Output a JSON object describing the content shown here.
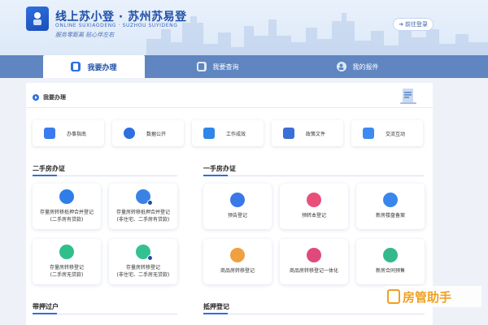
{
  "header": {
    "title": "线上苏小登 · 苏州苏易登",
    "subtitle": "ONLINE SUXIAODENG · SUZHOU SUYIDENG",
    "slogan": "服务零距离   贴心伴左右",
    "login_label": "前往登录"
  },
  "nav": {
    "tabs": [
      {
        "label": "我要办理",
        "active": true
      },
      {
        "label": "我要查询",
        "active": false
      },
      {
        "label": "我的报件",
        "active": false
      }
    ]
  },
  "main": {
    "breadcrumb": "我要办理",
    "quick_links": [
      {
        "label": "办事指南",
        "icon": "guide-icon",
        "color": "#3a7cf0"
      },
      {
        "label": "数据公开",
        "icon": "pie-chart-icon",
        "color": "#2f6fe0"
      },
      {
        "label": "工作成效",
        "icon": "trophy-icon",
        "color": "#2f86e8"
      },
      {
        "label": "政策文件",
        "icon": "document-icon",
        "color": "#3a6fd6"
      },
      {
        "label": "交流互动",
        "icon": "chat-icon",
        "color": "#3d8af0"
      }
    ],
    "sections": {
      "second_hand": {
        "title": "二手房办证",
        "cards": [
          {
            "line1": "存量房转移抵押合并登记",
            "line2": "(二手房有贷款)",
            "icon": "house-arrow-icon",
            "color": "#2f7de8"
          },
          {
            "line1": "存量房转移抵押合并登记",
            "line2": "(非住宅、二手房有贷款)",
            "icon": "house-arrow-icon",
            "color": "#3b82e6"
          },
          {
            "line1": "存量房转移登记",
            "line2": "(二手房无贷款)",
            "icon": "house-refresh-icon",
            "color": "#2fbf8a"
          },
          {
            "line1": "存量房转移登记",
            "line2": "(非住宅、二手房无贷款)",
            "icon": "house-refresh-icon",
            "color": "#34c191"
          }
        ]
      },
      "first_hand": {
        "title": "一手房办证",
        "cards": [
          {
            "line1": "预告登记",
            "line2": "",
            "icon": "bell-icon",
            "color": "#3878e8"
          },
          {
            "line1": "预转本登记",
            "line2": "",
            "icon": "transfer-icon",
            "color": "#e8507a"
          },
          {
            "line1": "新房楼盘备案",
            "line2": "",
            "icon": "building-icon",
            "color": "#3b86ec"
          },
          {
            "line1": "商品房转移登记",
            "line2": "",
            "icon": "certificate-icon",
            "color": "#f0a040"
          },
          {
            "line1": "商品房转移登记一体化",
            "line2": "",
            "icon": "integration-icon",
            "color": "#e04a7a"
          },
          {
            "line1": "新房合同预售",
            "line2": "",
            "icon": "contract-icon",
            "color": "#35b98a"
          }
        ]
      },
      "mortgage_transfer": {
        "title": "带押过户"
      },
      "mortgage_registration": {
        "title": "抵押登记"
      }
    }
  },
  "watermark": {
    "text": "房管助手"
  }
}
